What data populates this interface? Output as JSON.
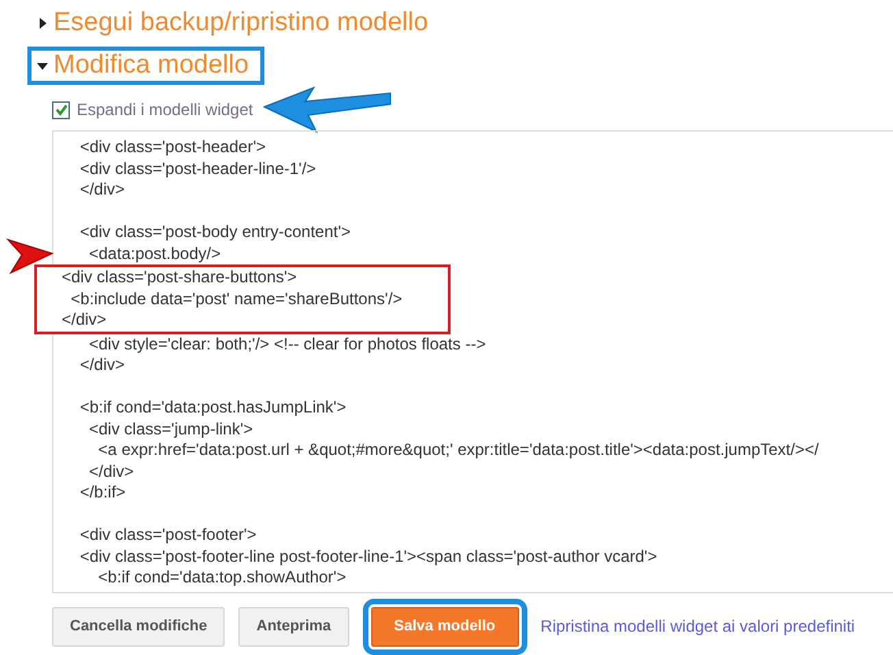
{
  "sections": [
    {
      "title": "Esegui backup/ripristino modello",
      "expanded": false,
      "highlighted": false
    },
    {
      "title": "Modifica modello",
      "expanded": true,
      "highlighted": true
    }
  ],
  "expand_widgets": {
    "label": "Espandi i modelli widget",
    "checked": true
  },
  "code_lines": [
    {
      "kind": "code",
      "text": "    <div class='post-header'>",
      "highlighted": false
    },
    {
      "kind": "code",
      "text": "    <div class='post-header-line-1'/>",
      "highlighted": false
    },
    {
      "kind": "code",
      "text": "    </div>",
      "highlighted": false
    },
    {
      "kind": "blank"
    },
    {
      "kind": "code",
      "text": "    <div class='post-body entry-content'>",
      "highlighted": false
    },
    {
      "kind": "code",
      "text": "      <data:post.body/>",
      "highlighted": false
    },
    {
      "kind": "code",
      "text": "<div class='post-share-buttons'>",
      "highlighted": true
    },
    {
      "kind": "code",
      "text": "  <b:include data='post' name='shareButtons'/>",
      "highlighted": true
    },
    {
      "kind": "code",
      "text": "</div>",
      "highlighted": true
    },
    {
      "kind": "code",
      "text": "      <div style='clear: both;'/> <!-- clear for photos floats -->",
      "highlighted": false
    },
    {
      "kind": "code",
      "text": "    </div>",
      "highlighted": false
    },
    {
      "kind": "blank"
    },
    {
      "kind": "code",
      "text": "    <b:if cond='data:post.hasJumpLink'>",
      "highlighted": false
    },
    {
      "kind": "code",
      "text": "      <div class='jump-link'>",
      "highlighted": false
    },
    {
      "kind": "code",
      "text": "        <a expr:href='data:post.url + &quot;#more&quot;' expr:title='data:post.title'><data:post.jumpText/></",
      "highlighted": false
    },
    {
      "kind": "code",
      "text": "      </div>",
      "highlighted": false
    },
    {
      "kind": "code",
      "text": "    </b:if>",
      "highlighted": false
    },
    {
      "kind": "blank"
    },
    {
      "kind": "code",
      "text": "    <div class='post-footer'>",
      "highlighted": false
    },
    {
      "kind": "code",
      "text": "    <div class='post-footer-line post-footer-line-1'><span class='post-author vcard'>",
      "highlighted": false
    },
    {
      "kind": "code",
      "text": "        <b:if cond='data:top.showAuthor'>",
      "highlighted": false
    }
  ],
  "buttons": [
    {
      "label": "Cancella modifiche",
      "kind": "secondary",
      "highlighted": false
    },
    {
      "label": "Anteprima",
      "kind": "secondary",
      "highlighted": false
    },
    {
      "label": "Salva modello",
      "kind": "primary",
      "highlighted": true
    }
  ],
  "link": "Ripristina modelli widget ai valori predefiniti"
}
